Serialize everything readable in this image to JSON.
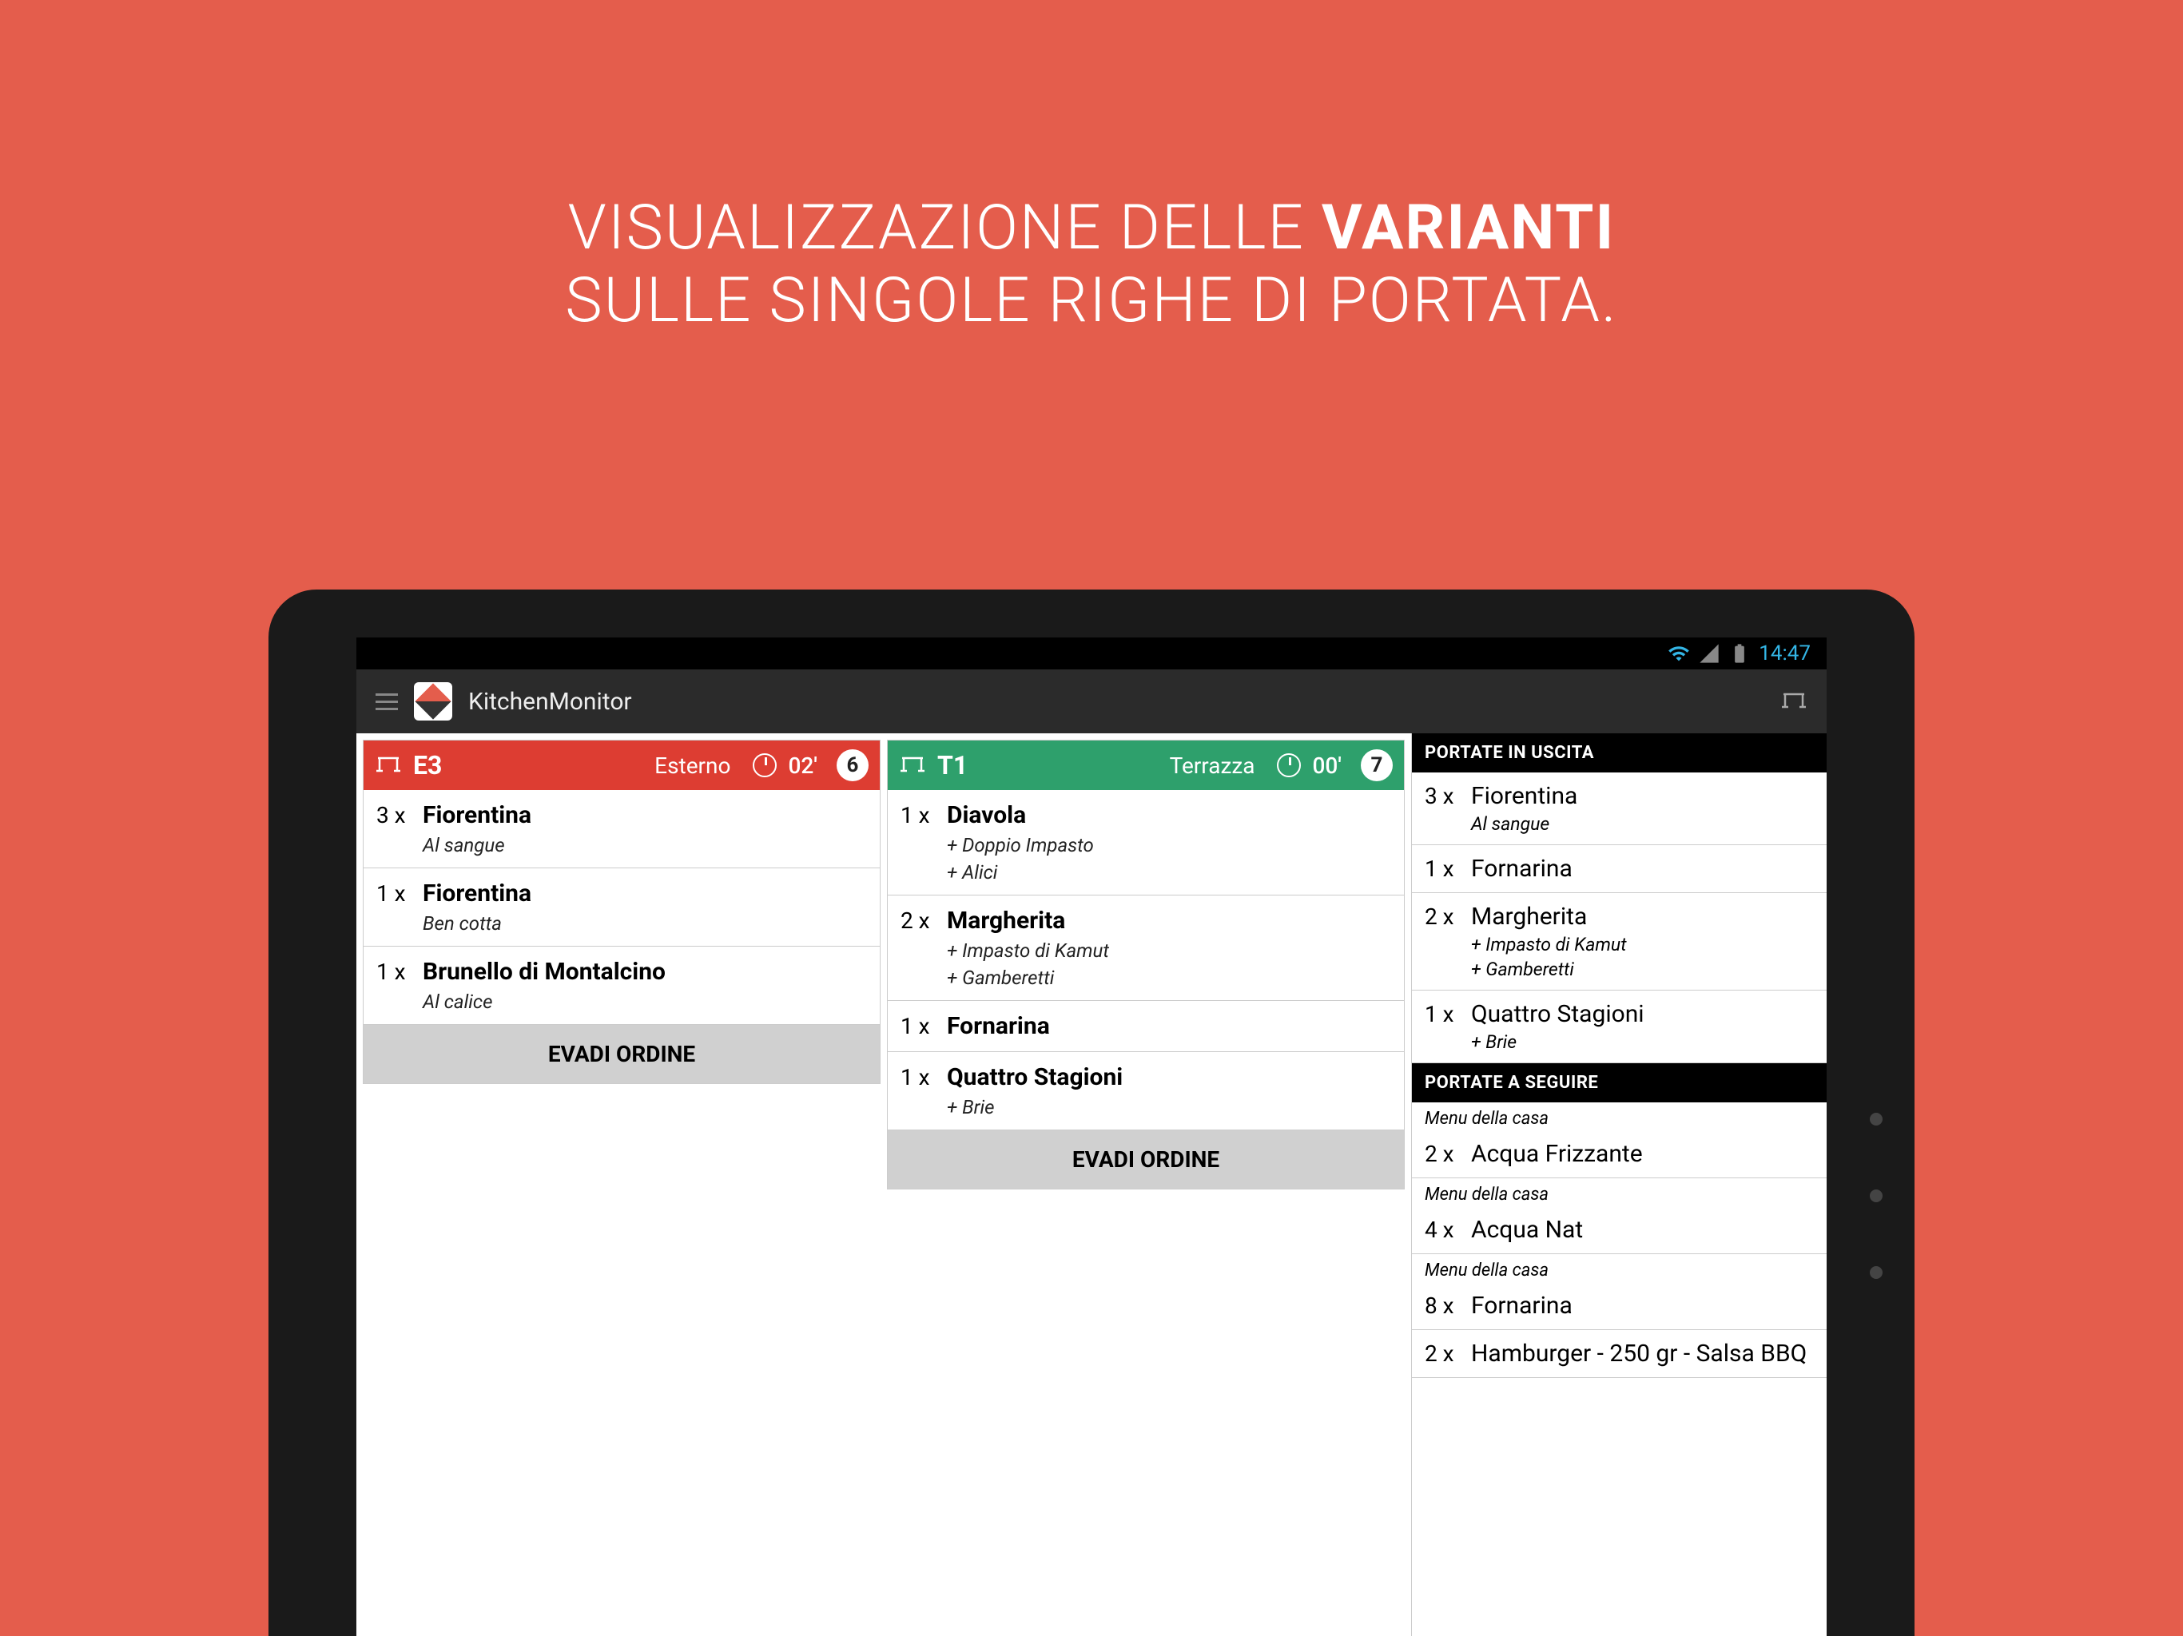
{
  "headline": {
    "part1": "VISUALIZZAZIONE DELLE ",
    "bold": "VARIANTI",
    "part2": "SULLE SINGOLE RIGHE DI PORTATA."
  },
  "status": {
    "time": "14:47"
  },
  "app": {
    "title": "KitchenMonitor"
  },
  "orders": [
    {
      "color": "red",
      "code": "E3",
      "area": "Esterno",
      "timer": "02'",
      "count": "6",
      "items": [
        {
          "qty": "3 x",
          "name": "Fiorentina",
          "variants": [
            "Al sangue"
          ]
        },
        {
          "qty": "1 x",
          "name": "Fiorentina",
          "variants": [
            "Ben cotta"
          ]
        },
        {
          "qty": "1 x",
          "name": "Brunello di Montalcino",
          "variants": [
            "Al calice"
          ]
        }
      ],
      "action": "EVADI ORDINE"
    },
    {
      "color": "green",
      "code": "T1",
      "area": "Terrazza",
      "timer": "00'",
      "count": "7",
      "items": [
        {
          "qty": "1 x",
          "name": "Diavola",
          "variants": [
            "+ Doppio Impasto",
            "+ Alici"
          ]
        },
        {
          "qty": "2 x",
          "name": "Margherita",
          "variants": [
            "+ Impasto di Kamut",
            "+ Gamberetti"
          ]
        },
        {
          "qty": "1 x",
          "name": "Fornarina",
          "variants": []
        },
        {
          "qty": "1 x",
          "name": "Quattro Stagioni",
          "variants": [
            "+ Brie"
          ]
        }
      ],
      "action": "EVADI ORDINE"
    }
  ],
  "sidebar": {
    "section1": {
      "title": "PORTATE IN USCITA",
      "items": [
        {
          "qty": "3 x",
          "name": "Fiorentina",
          "variants": [
            "Al sangue"
          ]
        },
        {
          "qty": "1 x",
          "name": "Fornarina",
          "variants": []
        },
        {
          "qty": "2 x",
          "name": "Margherita",
          "variants": [
            "+ Impasto di Kamut",
            "+ Gamberetti"
          ]
        },
        {
          "qty": "1 x",
          "name": "Quattro Stagioni",
          "variants": [
            "+ Brie"
          ]
        }
      ]
    },
    "section2": {
      "title": "PORTATE A SEGUIRE",
      "items": [
        {
          "menu": "Menu della casa",
          "qty": "2 x",
          "name": "Acqua Frizzante"
        },
        {
          "menu": "Menu della casa",
          "qty": "4 x",
          "name": "Acqua Nat"
        },
        {
          "menu": "Menu della casa",
          "qty": "8 x",
          "name": "Fornarina"
        },
        {
          "qty": "2 x",
          "name": "Hamburger - 250 gr - Salsa BBQ"
        }
      ]
    }
  }
}
